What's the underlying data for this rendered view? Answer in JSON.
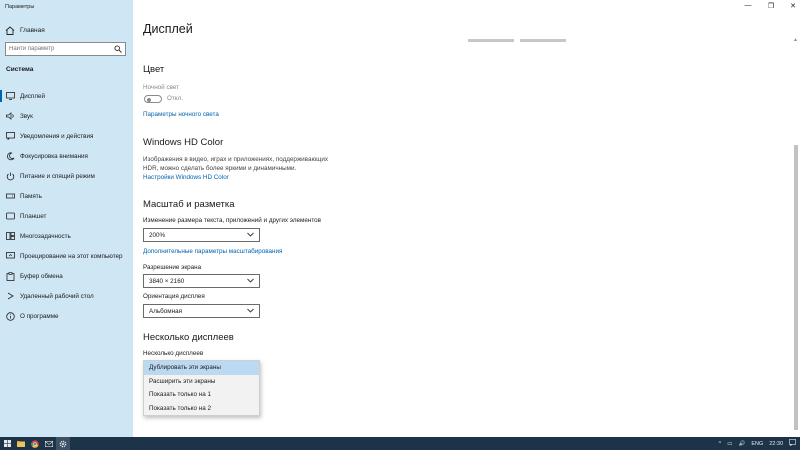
{
  "window": {
    "title": "Параметры",
    "minimize": "—",
    "maximize": "❐",
    "close": "✕"
  },
  "sidebar": {
    "home_label": "Главная",
    "search": {
      "placeholder": "Найти параметр",
      "value": "Найти параметр"
    },
    "section": "Система",
    "items": [
      {
        "label": "Дисплей",
        "icon": "display-icon",
        "active": true
      },
      {
        "label": "Звук",
        "icon": "sound-icon"
      },
      {
        "label": "Уведомления и действия",
        "icon": "notifications-icon"
      },
      {
        "label": "Фокусировка внимания",
        "icon": "focus-assist-icon"
      },
      {
        "label": "Питание и спящий режим",
        "icon": "power-icon"
      },
      {
        "label": "Память",
        "icon": "storage-icon"
      },
      {
        "label": "Планшет",
        "icon": "tablet-icon"
      },
      {
        "label": "Многозадачность",
        "icon": "multitasking-icon"
      },
      {
        "label": "Проецирование на этот компьютер",
        "icon": "projecting-icon"
      },
      {
        "label": "Буфер обмена",
        "icon": "clipboard-icon"
      },
      {
        "label": "Удаленный рабочий стол",
        "icon": "remote-desktop-icon"
      },
      {
        "label": "О программе",
        "icon": "info-icon"
      }
    ]
  },
  "main": {
    "title": "Дисплей",
    "color": {
      "heading": "Цвет",
      "night_light_label": "Ночной свет",
      "toggle_state": "Откл.",
      "night_light_link": "Параметры ночного света"
    },
    "hd_color": {
      "heading": "Windows HD Color",
      "desc_line1": "Изображения в видео, играх и приложениях, поддерживающих",
      "desc_line2": "HDR, можно сделать более яркими и динамичными.",
      "link": "Настройки Windows HD Color"
    },
    "scale": {
      "heading": "Масштаб и разметка",
      "size_label": "Изменение размера текста, приложений и других элементов",
      "size_value": "200%",
      "advanced_link": "Дополнительные параметры масштабирования",
      "resolution_label": "Разрешение экрана",
      "resolution_value": "3840 × 2160",
      "orientation_label": "Ориентация дисплея",
      "orientation_value": "Альбомная"
    },
    "multi": {
      "heading": "Несколько дисплеев",
      "label": "Несколько дисплеев",
      "options": [
        "Дублировать эти экраны",
        "Расширить эти экраны",
        "Показать только на 1",
        "Показать только на 2"
      ],
      "selected_index": 0
    }
  },
  "taskbar": {
    "lang": "ENG",
    "time": "22:30",
    "chevron": "^",
    "volume": "🔊",
    "notification": "▭"
  },
  "colors": {
    "sidebar_bg": "#cfe6f5",
    "accent": "#0063b1",
    "taskbar_bg": "#1d3347",
    "selected_option": "#bcd9f2"
  }
}
